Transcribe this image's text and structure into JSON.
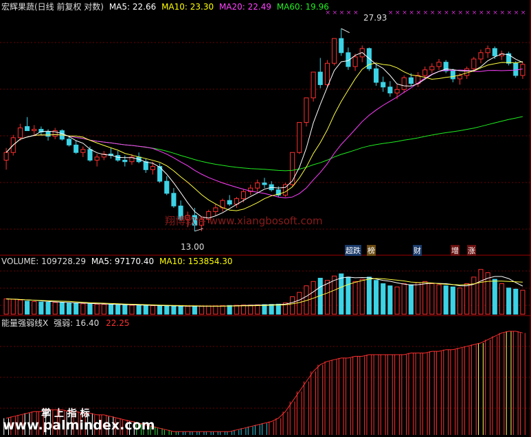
{
  "header": {
    "title": "宏辉果蔬(日线 前复权 对数)",
    "ma5": "MA5: 22.66",
    "ma10": "MA10: 23.30",
    "ma20": "MA20: 22.49",
    "ma60": "MA60: 19.96"
  },
  "price_labels": {
    "high": "27.93",
    "low": "13.00"
  },
  "watermark": "翔博软件 www.xiangbosoft.com",
  "tags": [
    "超跌",
    "榜",
    "财",
    "增",
    "涨"
  ],
  "volume_header": {
    "label": "VOLUME: 109728.29",
    "ma5": "MA5: 97170.40",
    "ma10": "MA10: 153854.30"
  },
  "indicator_header": {
    "name": "能量强弱线X",
    "v1": "强弱: 16.40",
    "v2": "22.25"
  },
  "bottom_overlay": "掌 上 指 标",
  "site": "www.palmindex.com",
  "colors": {
    "up": "#ff3030",
    "down": "#3cd3e6",
    "ma5": "#ffffff",
    "ma10": "#ffff40",
    "ma20": "#ff40ff",
    "ma60": "#20ee20"
  },
  "chart_data": {
    "type": "candlestick",
    "price": {
      "ohlc": [
        [
          17.0,
          17.8,
          16.4,
          17.5
        ],
        [
          17.5,
          18.7,
          17.3,
          18.5
        ],
        [
          18.5,
          19.5,
          18.3,
          19.2
        ],
        [
          19.3,
          20.0,
          19.0,
          19.0
        ],
        [
          19.0,
          19.4,
          18.6,
          19.1
        ],
        [
          19.1,
          19.3,
          18.7,
          18.9
        ],
        [
          18.9,
          19.1,
          18.3,
          18.6
        ],
        [
          18.6,
          19.2,
          18.4,
          19.0
        ],
        [
          19.0,
          19.1,
          18.3,
          18.4
        ],
        [
          18.4,
          18.6,
          17.9,
          18.0
        ],
        [
          18.0,
          18.3,
          17.4,
          17.5
        ],
        [
          17.5,
          17.9,
          17.2,
          17.7
        ],
        [
          17.7,
          17.9,
          16.9,
          17.0
        ],
        [
          17.0,
          17.4,
          16.6,
          17.2
        ],
        [
          17.2,
          17.6,
          17.0,
          17.4
        ],
        [
          17.4,
          17.8,
          17.1,
          17.3
        ],
        [
          17.3,
          17.6,
          16.9,
          17.0
        ],
        [
          17.0,
          17.3,
          16.6,
          16.9
        ],
        [
          16.9,
          17.4,
          16.7,
          17.2
        ],
        [
          17.2,
          17.5,
          16.8,
          16.9
        ],
        [
          16.9,
          17.1,
          16.2,
          16.4
        ],
        [
          16.4,
          16.9,
          16.1,
          16.6
        ],
        [
          16.6,
          16.8,
          15.6,
          15.7
        ],
        [
          15.7,
          16.0,
          14.9,
          15.0
        ],
        [
          15.0,
          15.3,
          14.2,
          14.3
        ],
        [
          14.3,
          14.6,
          13.5,
          13.6
        ],
        [
          13.6,
          14.0,
          13.2,
          13.8
        ],
        [
          13.8,
          14.2,
          13.0,
          13.3
        ],
        [
          13.3,
          13.7,
          13.0,
          13.6
        ],
        [
          13.6,
          14.1,
          13.4,
          14.0
        ],
        [
          14.0,
          14.4,
          13.8,
          14.2
        ],
        [
          14.2,
          14.7,
          14.0,
          14.6
        ],
        [
          14.6,
          14.9,
          14.3,
          14.4
        ],
        [
          14.4,
          14.8,
          14.2,
          14.7
        ],
        [
          14.7,
          15.2,
          14.5,
          15.1
        ],
        [
          15.1,
          15.5,
          14.9,
          15.3
        ],
        [
          15.3,
          15.8,
          15.1,
          15.6
        ],
        [
          15.6,
          15.9,
          15.3,
          15.5
        ],
        [
          15.5,
          15.7,
          15.1,
          15.2
        ],
        [
          15.2,
          15.4,
          14.8,
          14.9
        ],
        [
          14.9,
          15.6,
          14.8,
          15.5
        ],
        [
          15.5,
          17.5,
          15.4,
          17.5
        ],
        [
          17.5,
          19.6,
          17.4,
          19.6
        ],
        [
          19.6,
          21.5,
          19.3,
          21.5
        ],
        [
          21.5,
          23.7,
          21.2,
          23.7
        ],
        [
          23.7,
          25.0,
          22.3,
          22.6
        ],
        [
          22.6,
          24.8,
          22.4,
          24.5
        ],
        [
          24.5,
          26.9,
          24.3,
          26.9
        ],
        [
          26.9,
          27.93,
          25.2,
          25.5
        ],
        [
          25.5,
          26.0,
          23.9,
          24.2
        ],
        [
          24.2,
          25.4,
          23.8,
          25.1
        ],
        [
          25.1,
          26.2,
          24.6,
          25.9
        ],
        [
          25.9,
          26.0,
          23.8,
          24.0
        ],
        [
          24.0,
          24.4,
          22.5,
          22.8
        ],
        [
          22.8,
          23.3,
          22.0,
          22.4
        ],
        [
          22.4,
          22.9,
          21.6,
          21.9
        ],
        [
          21.9,
          22.6,
          21.4,
          22.2
        ],
        [
          22.2,
          23.4,
          21.9,
          23.2
        ],
        [
          23.2,
          23.6,
          22.5,
          22.7
        ],
        [
          22.7,
          23.7,
          22.4,
          23.4
        ],
        [
          23.4,
          24.2,
          23.1,
          23.9
        ],
        [
          23.9,
          24.5,
          23.6,
          24.2
        ],
        [
          24.2,
          24.9,
          23.9,
          24.6
        ],
        [
          24.6,
          24.8,
          23.6,
          23.8
        ],
        [
          23.8,
          24.0,
          22.8,
          23.1
        ],
        [
          23.1,
          23.6,
          22.6,
          23.4
        ],
        [
          23.4,
          24.2,
          23.1,
          24.0
        ],
        [
          24.0,
          25.1,
          23.8,
          24.9
        ],
        [
          24.9,
          25.8,
          24.5,
          25.5
        ],
        [
          25.5,
          26.2,
          25.0,
          25.9
        ],
        [
          25.9,
          26.1,
          24.9,
          25.2
        ],
        [
          25.2,
          25.7,
          24.8,
          25.4
        ],
        [
          25.4,
          25.6,
          24.3,
          24.5
        ],
        [
          24.5,
          24.7,
          23.2,
          23.4
        ],
        [
          23.4,
          24.6,
          23.1,
          24.4
        ]
      ],
      "ylim": [
        12.0,
        30.0
      ],
      "labels": {
        "high": 27.93,
        "low": 13.0
      }
    },
    "volume": {
      "values": [
        70000,
        68000,
        65000,
        60000,
        58000,
        56000,
        55000,
        54000,
        52000,
        50000,
        49000,
        48000,
        47000,
        46000,
        45000,
        44000,
        43000,
        42000,
        41000,
        40000,
        40000,
        39000,
        38000,
        38000,
        37000,
        37000,
        36000,
        36000,
        36000,
        37000,
        38000,
        39000,
        40000,
        41000,
        42000,
        42000,
        43000,
        44000,
        45000,
        46000,
        52000,
        80000,
        100000,
        130000,
        150000,
        165000,
        155000,
        175000,
        185000,
        170000,
        150000,
        160000,
        170000,
        155000,
        140000,
        130000,
        125000,
        140000,
        135000,
        145000,
        150000,
        140000,
        135000,
        130000,
        125000,
        120000,
        140000,
        170000,
        205000,
        190000,
        160000,
        140000,
        120000,
        115000,
        109728
      ],
      "ma5": 97170.4,
      "ma10": 153854.3,
      "ylim": [
        0,
        220000
      ]
    },
    "indicator": {
      "values": [
        2,
        3,
        4,
        5,
        6,
        6,
        7,
        7,
        7,
        6,
        6,
        5,
        5,
        4,
        4,
        3,
        2,
        1,
        0,
        -1,
        -2,
        -3,
        -4,
        -5,
        -6,
        -6,
        -6,
        -6,
        -6,
        -6,
        -6,
        -6,
        -6,
        -5,
        -4,
        -3,
        -2,
        -1,
        0,
        2,
        6,
        12,
        18,
        24,
        30,
        34,
        36,
        37,
        38,
        38,
        39,
        39,
        40,
        40,
        40,
        40,
        40,
        40,
        41,
        41,
        41,
        42,
        42,
        43,
        43,
        44,
        45,
        46,
        47,
        49,
        51,
        53,
        54,
        54,
        53
      ],
      "ylim": [
        -8,
        56
      ],
      "v1": 16.4,
      "v2": 22.25
    }
  }
}
